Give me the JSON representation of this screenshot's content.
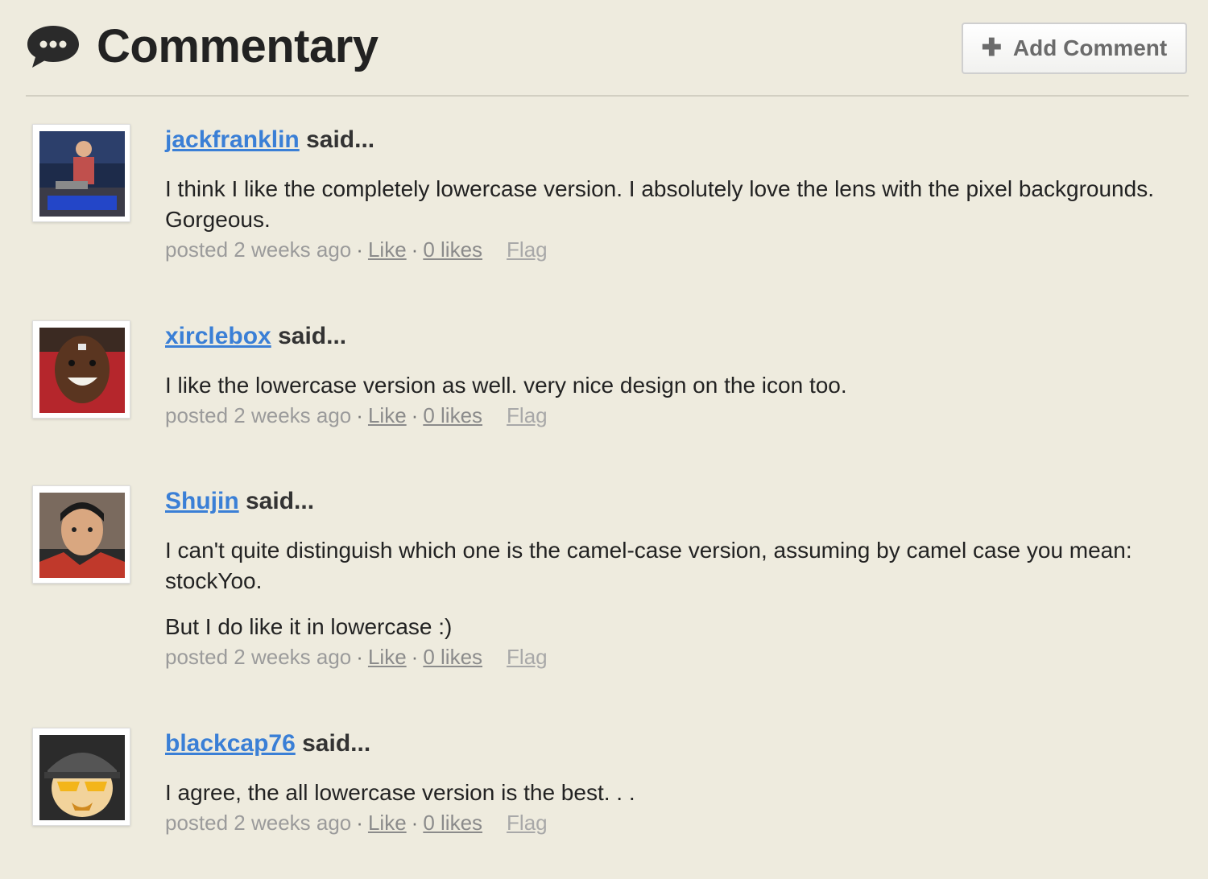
{
  "header": {
    "title": "Commentary",
    "add_comment_label": "Add Comment",
    "plus_glyph": "✚"
  },
  "comments": [
    {
      "username": "jackfranklin",
      "said": "said...",
      "paragraphs": [
        "I think I like the completely lowercase version. I absolutely love the lens with the pixel backgrounds. Gorgeous."
      ],
      "posted": "posted 2 weeks ago",
      "like_label": "Like",
      "likes_count": "0 likes",
      "flag_label": "Flag"
    },
    {
      "username": "xirclebox",
      "said": "said...",
      "paragraphs": [
        "I like the lowercase version as well. very nice design on the icon too."
      ],
      "posted": "posted 2 weeks ago",
      "like_label": "Like",
      "likes_count": "0 likes",
      "flag_label": "Flag"
    },
    {
      "username": "Shujin",
      "said": "said...",
      "paragraphs": [
        "I can't quite distinguish which one is the camel-case version, assuming by camel case you mean: stockYoo.",
        "But I do like it in lowercase :)"
      ],
      "posted": "posted 2 weeks ago",
      "like_label": "Like",
      "likes_count": "0 likes",
      "flag_label": "Flag"
    },
    {
      "username": "blackcap76",
      "said": "said...",
      "paragraphs": [
        "I agree, the all lowercase version is the best. . ."
      ],
      "posted": "posted 2 weeks ago",
      "like_label": "Like",
      "likes_count": "0 likes",
      "flag_label": "Flag"
    }
  ],
  "colors": {
    "background": "#eeebde",
    "link": "#3a7fd6",
    "meta": "#9b9b9b"
  }
}
